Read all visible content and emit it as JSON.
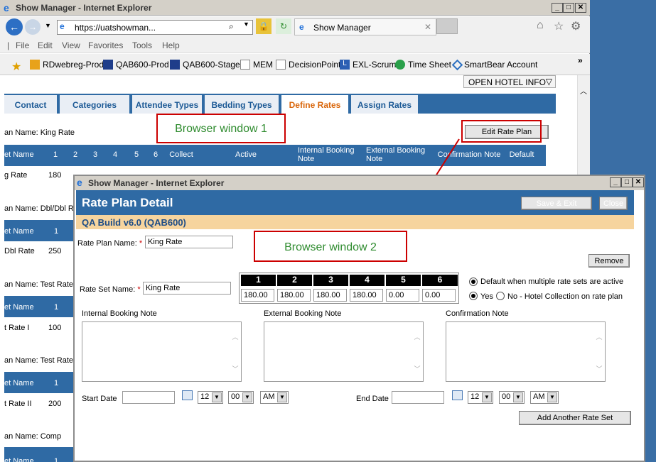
{
  "browser1": {
    "title": "Show Manager - Internet Explorer",
    "url": "https://uatshowman...",
    "tab_title": "Show Manager"
  },
  "menu": [
    "File",
    "Edit",
    "View",
    "Favorites",
    "Tools",
    "Help"
  ],
  "favorites": [
    "RDwebreg-Prod",
    "QAB600-Prod",
    "QAB600-Stage",
    "MEM",
    "DecisionPoint",
    "EXL-Scrum",
    "Time Sheet",
    "SmartBear Account"
  ],
  "open_hotel_info": "OPEN HOTEL INFO",
  "tabs": [
    "Contact",
    "Categories",
    "Attendee Types",
    "Bedding Types",
    "Define Rates",
    "Assign Rates"
  ],
  "active_tab": "Define Rates",
  "edit_rate_plan": "Edit Rate Plan",
  "callout1": "Browser window 1",
  "callout2": "Browser window 2",
  "columns": [
    "et Name",
    "1",
    "2",
    "3",
    "4",
    "5",
    "6",
    "Collect",
    "Active",
    "Internal Booking Note",
    "External Booking Note",
    "Confirmation Note",
    "Default"
  ],
  "plans": [
    {
      "name": "an Name: King Rate",
      "row_name": "g Rate",
      "v1": "180"
    },
    {
      "name": "an Name: Dbl/Dbl Ra",
      "row_name": "Dbl Rate",
      "v1": "250"
    },
    {
      "name": "an Name: Test Rate",
      "row_name": "t Rate I",
      "v1": "100"
    },
    {
      "name": "an Name: Test Rate",
      "row_name": "t Rate II",
      "v1": "200"
    },
    {
      "name": "an Name: Comp",
      "row_name": "",
      "v1": ""
    }
  ],
  "browser2": {
    "title": "Show Manager - Internet Explorer"
  },
  "rpd": {
    "title": "Rate Plan Detail",
    "save_exit": "Save & Exit",
    "close": "Close",
    "build": "QA Build v6.0 (QAB600)",
    "plan_name_label": "Rate Plan Name:",
    "plan_name": "King Rate",
    "remove": "Remove",
    "set_name_label": "Rate Set Name:",
    "set_name": "King Rate",
    "rate_headers": [
      "1",
      "2",
      "3",
      "4",
      "5",
      "6"
    ],
    "rate_values": [
      "180.00",
      "180.00",
      "180.00",
      "180.00",
      "0.00",
      "0.00"
    ],
    "default_label": "Default when multiple rate sets are active",
    "yes": "Yes",
    "no": "No - Hotel Collection on rate plan",
    "internal_note": "Internal Booking Note",
    "external_note": "External Booking Note",
    "confirmation_note": "Confirmation Note",
    "start_date": "Start Date",
    "end_date": "End Date",
    "hour": "12",
    "minute": "00",
    "ampm": "AM",
    "add_another": "Add Another Rate Set"
  }
}
